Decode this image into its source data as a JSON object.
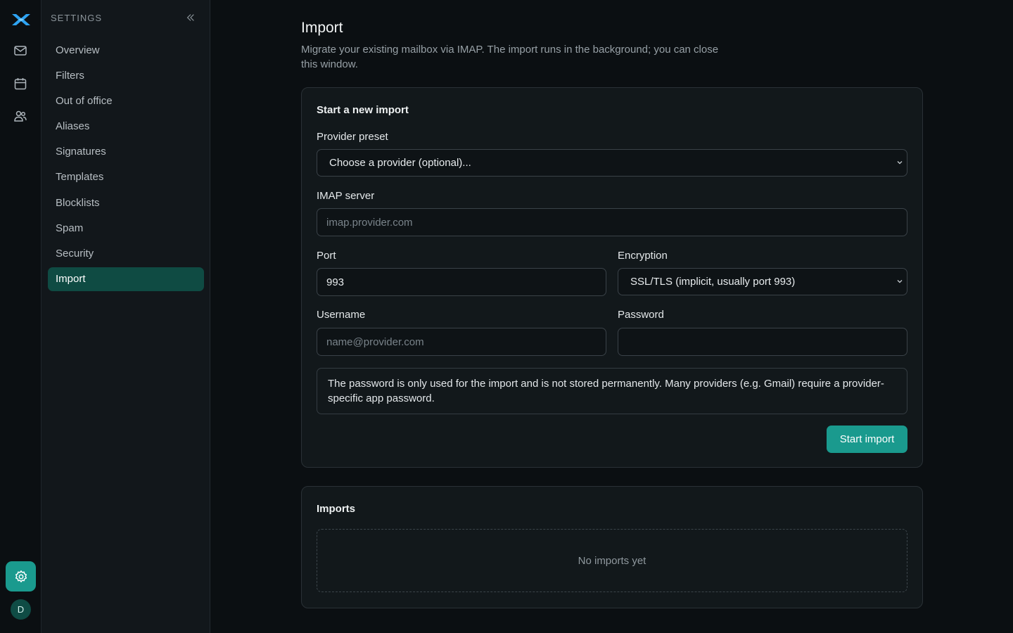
{
  "sidebar": {
    "title": "SETTINGS",
    "items": [
      {
        "label": "Overview"
      },
      {
        "label": "Filters"
      },
      {
        "label": "Out of office"
      },
      {
        "label": "Aliases"
      },
      {
        "label": "Signatures"
      },
      {
        "label": "Templates"
      },
      {
        "label": "Blocklists"
      },
      {
        "label": "Spam"
      },
      {
        "label": "Security"
      },
      {
        "label": "Import",
        "active": true
      }
    ]
  },
  "rail": {
    "icons": [
      "logo-icon",
      "mail-icon",
      "calendar-icon",
      "contacts-icon",
      "settings-icon"
    ],
    "avatar_initial": "D"
  },
  "page": {
    "title": "Import",
    "description": "Migrate your existing mailbox via IMAP. The import runs in the background; you can close this window."
  },
  "import_form": {
    "title": "Start a new import",
    "provider_label": "Provider preset",
    "provider_value": "Choose a provider (optional)...",
    "server_label": "IMAP server",
    "server_placeholder": "imap.provider.com",
    "port_label": "Port",
    "port_value": "993",
    "encryption_label": "Encryption",
    "encryption_value": "SSL/TLS (implicit, usually port 993)",
    "username_label": "Username",
    "username_placeholder": "name@provider.com",
    "password_label": "Password",
    "password_value": "",
    "info_text": "The password is only used for the import and is not stored permanently. Many providers (e.g. Gmail) require a provider-specific app password.",
    "submit_label": "Start import"
  },
  "imports": {
    "title": "Imports",
    "empty_text": "No imports yet"
  },
  "colors": {
    "accent": "#1a9a8e",
    "active_nav": "#0f4b43",
    "background": "#0b0f12"
  }
}
